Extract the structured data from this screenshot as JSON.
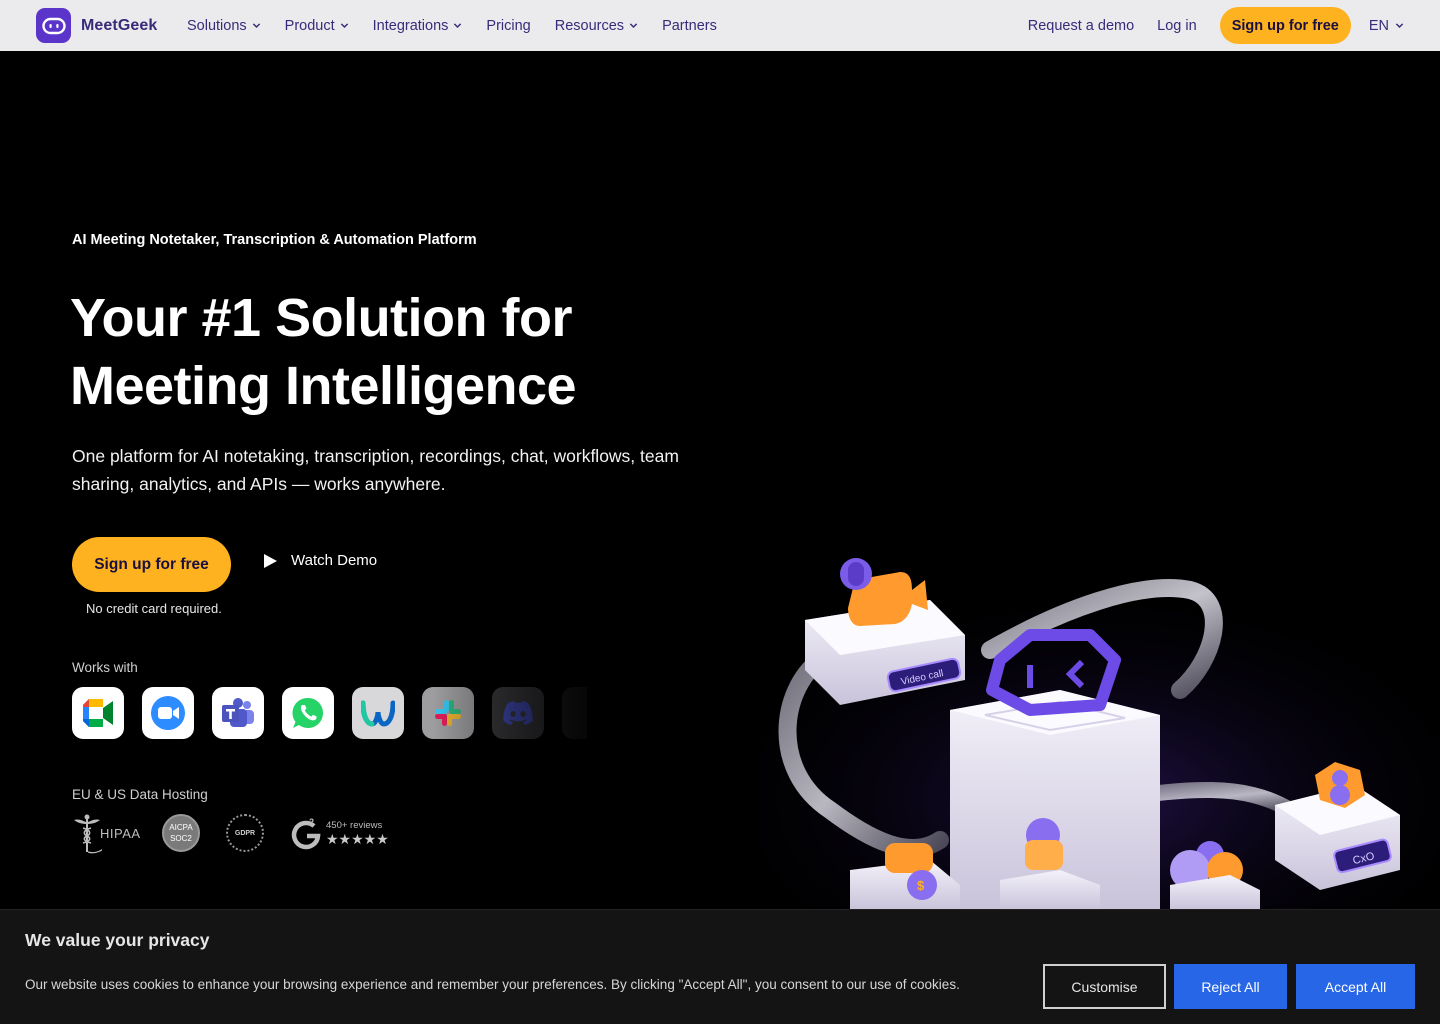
{
  "nav": {
    "brand": "MeetGeek",
    "links": [
      {
        "label": "Solutions",
        "dropdown": true
      },
      {
        "label": "Product",
        "dropdown": true
      },
      {
        "label": "Integrations",
        "dropdown": true
      },
      {
        "label": "Pricing",
        "dropdown": false
      },
      {
        "label": "Resources",
        "dropdown": true
      },
      {
        "label": "Partners",
        "dropdown": false
      }
    ],
    "request_demo": "Request a demo",
    "login": "Log in",
    "signup": "Sign up for free",
    "language": "EN"
  },
  "hero": {
    "eyebrow": "AI Meeting Notetaker, Transcription & Automation Platform",
    "title_line1": "Your #1 Solution for",
    "title_line2": "Meeting Intelligence",
    "lead": "One platform for AI notetaking, transcription, recordings, chat, workflows, team sharing, analytics, and APIs — works anywhere.",
    "cta": "Sign up for free",
    "watch_demo": "Watch Demo",
    "no_credit_card": "No credit card required.",
    "works_with_label": "Works with",
    "apps": [
      "google-meet-icon",
      "zoom-icon",
      "microsoft-teams-icon",
      "whatsapp-icon",
      "webex-icon",
      "slack-icon",
      "discord-icon",
      "more-app-icon"
    ],
    "hosting_label": "EU & US Data Hosting",
    "badges": {
      "hipaa": "HIPAA",
      "aicpa_top": "AICPA",
      "aicpa_bottom": "SOC2",
      "gdpr": "GDPR",
      "g2_reviews": "450+ reviews",
      "g2_stars": "★★★★★"
    }
  },
  "illustration": {
    "video_call_label": "Video call",
    "cxo_label": "CxO"
  },
  "cookie": {
    "title": "We value your privacy",
    "text": "Our website uses cookies to enhance your browsing experience and remember your preferences. By clicking \"Accept All\", you consent to our use of cookies.",
    "customise": "Customise",
    "reject": "Reject All",
    "accept": "Accept All"
  },
  "colors": {
    "brand_purple": "#5b34c9",
    "nav_text": "#3a2a7a",
    "accent_yellow": "#ffb21f",
    "cookie_blue": "#2766e6"
  }
}
